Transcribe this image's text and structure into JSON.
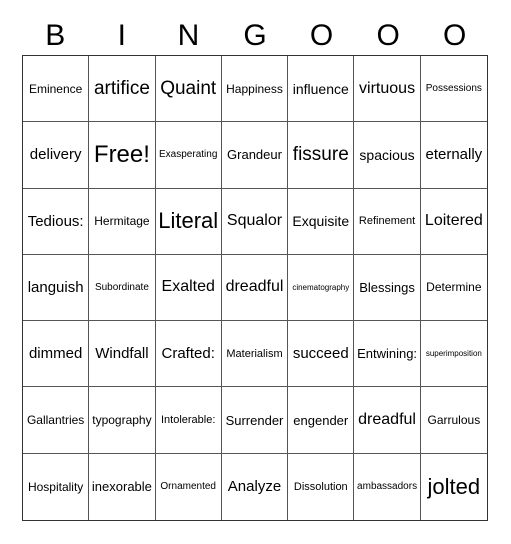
{
  "header": [
    "B",
    "I",
    "N",
    "G",
    "O",
    "O",
    "O"
  ],
  "rows": [
    [
      "Eminence",
      "artifice",
      "Quaint",
      "Happiness",
      "influence",
      "virtuous",
      "Possessions"
    ],
    [
      "delivery",
      "Free!",
      "Exasperating",
      "Grandeur",
      "fissure",
      "spacious",
      "eternally"
    ],
    [
      "Tedious:",
      "Hermitage",
      "Literal",
      "Squalor",
      "Exquisite",
      "Refinement",
      "Loitered"
    ],
    [
      "languish",
      "Subordinate",
      "Exalted",
      "dreadful",
      "cinematography",
      "Blessings",
      "Determine"
    ],
    [
      "dimmed",
      "Windfall",
      "Crafted:",
      "Materialism",
      "succeed",
      "Entwining:",
      "superimposition"
    ],
    [
      "Gallantries",
      "typography",
      "Intolerable:",
      "Surrender",
      "engender",
      "dreadful",
      "Garrulous"
    ],
    [
      "Hospitality",
      "inexorable",
      "Ornamented",
      "Analyze",
      "Dissolution",
      "ambassadors",
      "jolted"
    ]
  ]
}
